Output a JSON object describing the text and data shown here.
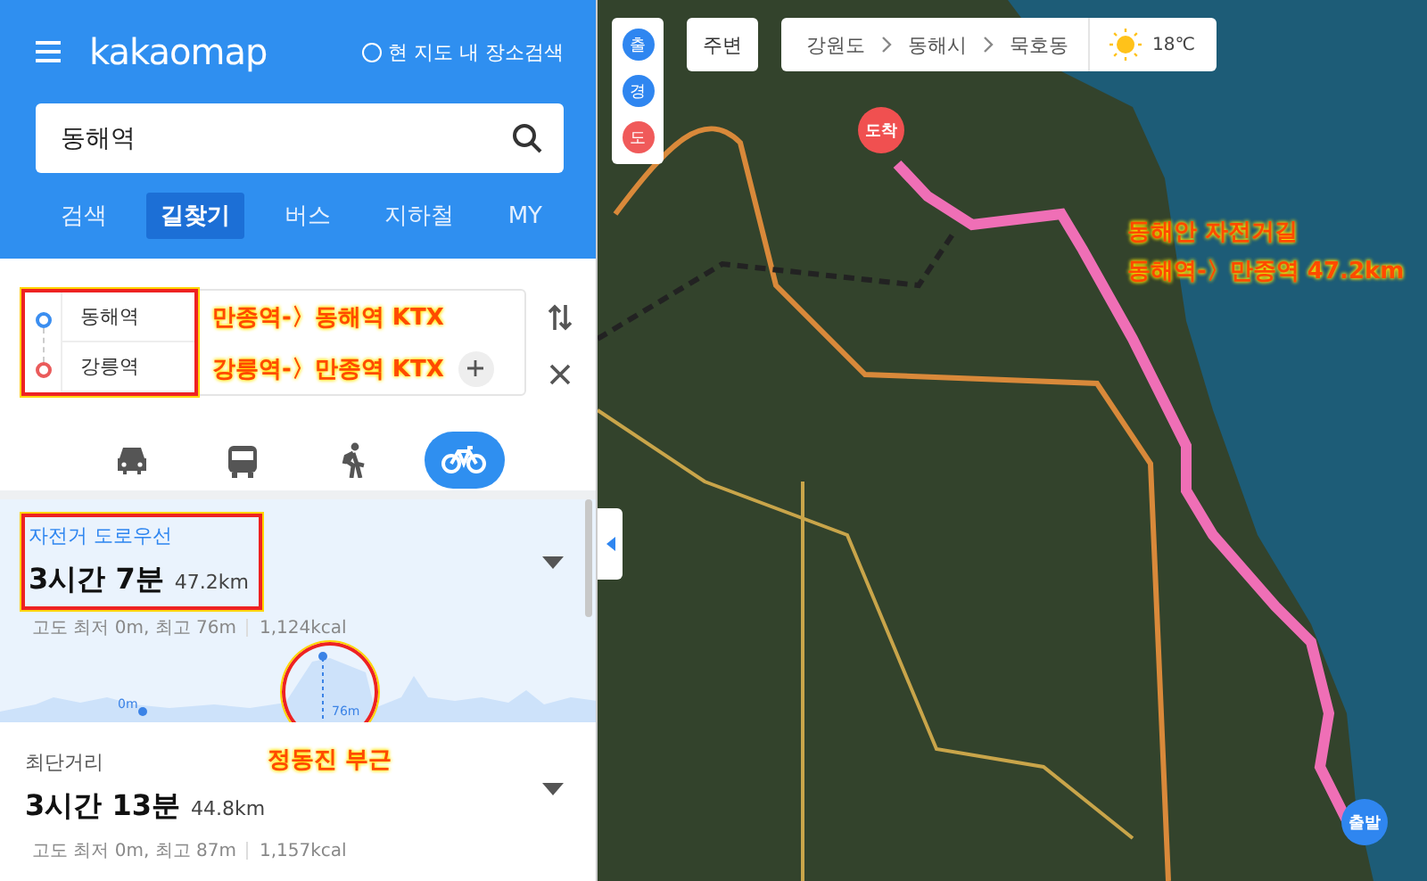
{
  "header": {
    "logo": "kakaomap",
    "area_search": {
      "label": "현 지도 내 장소검색",
      "checked": false
    }
  },
  "search": {
    "value": "동해역"
  },
  "tabs": [
    {
      "label": "검색",
      "selected": false
    },
    {
      "label": "길찾기",
      "selected": true
    },
    {
      "label": "버스",
      "selected": false
    },
    {
      "label": "지하철",
      "selected": false
    },
    {
      "label": "MY",
      "selected": false
    }
  ],
  "route_inputs": {
    "stops": [
      {
        "label": "동해역",
        "kind": "origin",
        "note": "만종역-〉동해역 KTX"
      },
      {
        "label": "강릉역",
        "kind": "destination",
        "note": "강릉역-〉만종역 KTX"
      }
    ]
  },
  "modes": [
    {
      "kind": "car",
      "selected": false
    },
    {
      "kind": "bus",
      "selected": false
    },
    {
      "kind": "walk",
      "selected": false
    },
    {
      "kind": "bike",
      "selected": true
    }
  ],
  "routes": [
    {
      "title": "자전거 도로우선",
      "time": "3시간 7분",
      "distance": "47.2km",
      "elevation": "고도 최저 0m, 최고 76m",
      "calories": "1,124kcal",
      "selected": true,
      "profile_labels": [
        "0m",
        "76m"
      ],
      "note": "정동진 부근"
    },
    {
      "title": "최단거리",
      "time": "3시간 13분",
      "distance": "44.8km",
      "elevation": "고도 최저 0m, 최고 87m",
      "calories": "1,157kcal",
      "selected": false
    }
  ],
  "map": {
    "pins": [
      {
        "label": "출",
        "color": "#2f86f0"
      },
      {
        "label": "경",
        "color": "#2f86f0"
      },
      {
        "label": "도",
        "color": "#f05a5a"
      }
    ],
    "nearby": "주변",
    "breadcrumb": [
      "강원도",
      "동해시",
      "묵호동"
    ],
    "weather": "18℃",
    "markers": [
      {
        "label": "도착",
        "kind": "arrival"
      },
      {
        "label": "출발",
        "kind": "departure"
      }
    ],
    "note": [
      "동해안 자전거길",
      "동해역-〉만종역 47.2km"
    ]
  }
}
